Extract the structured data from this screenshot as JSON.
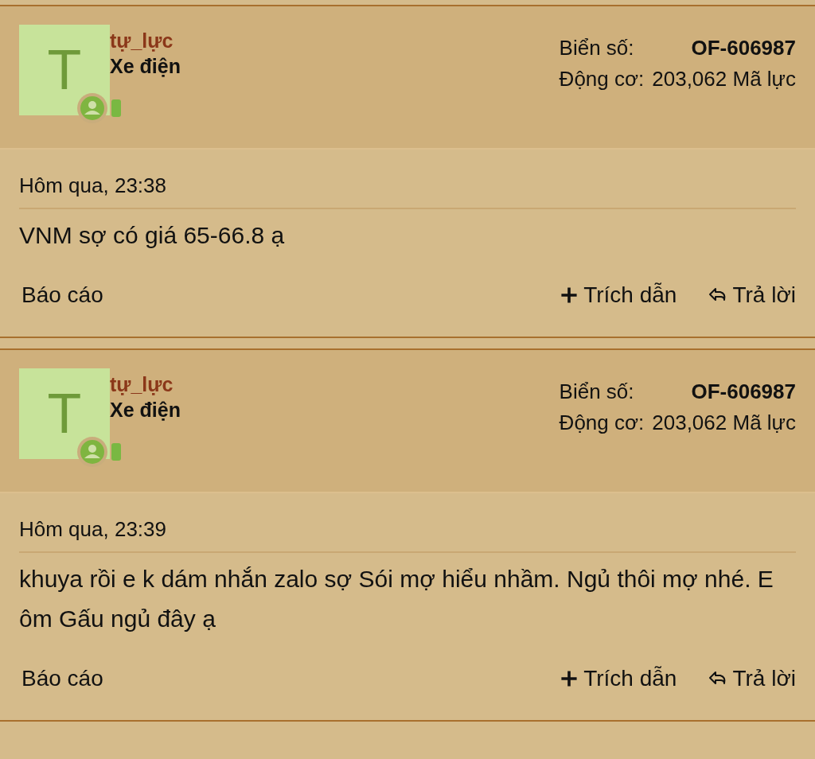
{
  "posts": [
    {
      "author": {
        "initial": "T",
        "username": "tự_lực",
        "title": "Xe điện",
        "online": true
      },
      "stats": [
        {
          "label": "Biển số:",
          "value": "OF-606987",
          "bold": true
        },
        {
          "label": "Động cơ:",
          "value": "203,062 Mã lực",
          "bold": false
        }
      ],
      "date": "Hôm qua, 23:38",
      "message": "VNM sợ có giá 65-66.8 ạ",
      "actions": {
        "report": "Báo cáo",
        "quote": "Trích dẫn",
        "reply": "Trả lời"
      }
    },
    {
      "author": {
        "initial": "T",
        "username": "tự_lực",
        "title": "Xe điện",
        "online": true
      },
      "stats": [
        {
          "label": "Biển số:",
          "value": "OF-606987",
          "bold": true
        },
        {
          "label": "Động cơ:",
          "value": "203,062 Mã lực",
          "bold": false
        }
      ],
      "date": "Hôm qua, 23:39",
      "message": "khuya rồi e k dám nhắn zalo sợ Sói mợ hiểu nhầm. Ngủ thôi mợ nhé. E ôm Gấu ngủ đây ạ",
      "actions": {
        "report": "Báo cáo",
        "quote": "Trích dẫn",
        "reply": "Trả lời"
      }
    }
  ]
}
